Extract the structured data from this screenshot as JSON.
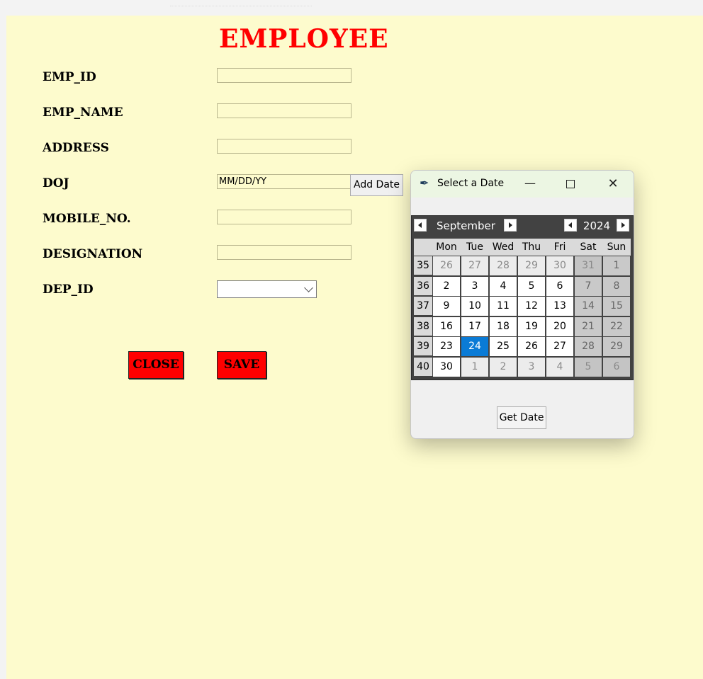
{
  "form": {
    "title": "EMPLOYEE",
    "fields": [
      {
        "label": "EMP_ID",
        "value": ""
      },
      {
        "label": "EMP_NAME",
        "value": ""
      },
      {
        "label": "ADDRESS",
        "value": ""
      },
      {
        "label": "DOJ",
        "value": "MM/DD/YY"
      },
      {
        "label": "MOBILE_NO.",
        "value": ""
      },
      {
        "label": "DESIGNATION",
        "value": ""
      },
      {
        "label": "DEP_ID",
        "value": ""
      }
    ],
    "add_date_label": "Add Date",
    "close_label": "CLOSE",
    "save_label": "SAVE",
    "colors": {
      "background": "#fdfbcd",
      "title": "#ff0000",
      "button": "#ff0000"
    }
  },
  "date_dialog": {
    "title": "Select a Date",
    "icon": "feather-icon",
    "month": "September",
    "year": "2024",
    "weekday_headers": [
      "Mon",
      "Tue",
      "Wed",
      "Thu",
      "Fri",
      "Sat",
      "Sun"
    ],
    "weeks": [
      {
        "week": "35",
        "days": [
          "26",
          "27",
          "28",
          "29",
          "30",
          "31",
          "1"
        ]
      },
      {
        "week": "36",
        "days": [
          "2",
          "3",
          "4",
          "5",
          "6",
          "7",
          "8"
        ]
      },
      {
        "week": "37",
        "days": [
          "9",
          "10",
          "11",
          "12",
          "13",
          "14",
          "15"
        ]
      },
      {
        "week": "38",
        "days": [
          "16",
          "17",
          "18",
          "19",
          "20",
          "21",
          "22"
        ]
      },
      {
        "week": "39",
        "days": [
          "23",
          "24",
          "25",
          "26",
          "27",
          "28",
          "29"
        ]
      },
      {
        "week": "40",
        "days": [
          "30",
          "1",
          "2",
          "3",
          "4",
          "5",
          "6"
        ]
      }
    ],
    "selected_day": "24",
    "get_date_label": "Get Date",
    "colors": {
      "selected": "#0a7bd6",
      "header_bar": "#424242"
    }
  }
}
